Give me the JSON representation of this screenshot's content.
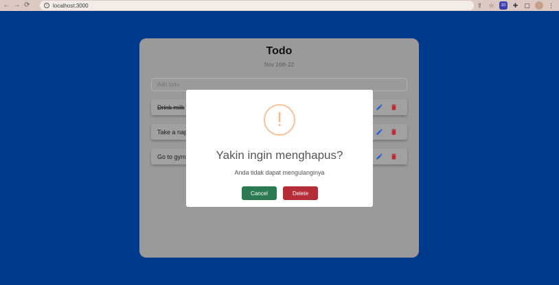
{
  "browser": {
    "url": "localhost:3000",
    "ext_badge": "10"
  },
  "todo": {
    "title": "Todo",
    "date": "Nov 16th 22",
    "add_placeholder": "Add todo",
    "items": [
      {
        "label": "Drink milk",
        "completed": true
      },
      {
        "label": "Take a nap",
        "completed": false
      },
      {
        "label": "Go to gym",
        "completed": false
      }
    ]
  },
  "modal": {
    "icon": "warning-icon",
    "title": "Yakin ingin menghapus?",
    "text": "Anda tidak dapat mengulanginya",
    "cancel_label": "Cancel",
    "delete_label": "Delete"
  },
  "colors": {
    "background": "#003a8c",
    "cancel": "#2c7a51",
    "delete": "#b42d37",
    "edit_icon": "#1f5fd1",
    "trash_icon": "#c1272d"
  }
}
